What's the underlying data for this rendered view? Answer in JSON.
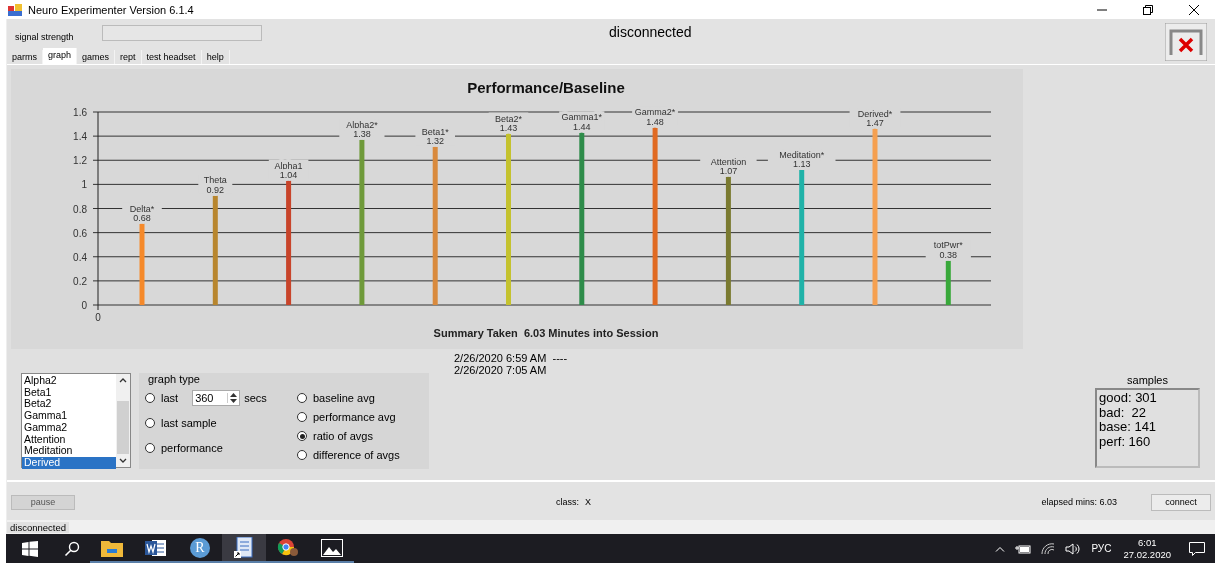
{
  "window": {
    "title": "Neuro Experimenter Version 6.1.4"
  },
  "header": {
    "signal_label": "signal strength",
    "status": "disconnected"
  },
  "tabs": [
    {
      "label": "parms",
      "selected": false
    },
    {
      "label": "graph",
      "selected": true
    },
    {
      "label": "games",
      "selected": false
    },
    {
      "label": "rept",
      "selected": false
    },
    {
      "label": "test headset",
      "selected": false
    },
    {
      "label": "help",
      "selected": false
    }
  ],
  "chart_data": {
    "type": "bar",
    "title": "Performance/Baseline",
    "xlabel": "Summary Taken  6.03 Minutes into Session",
    "series": [
      {
        "name": "Delta*",
        "color": "#f5892a",
        "values": [
          0.68
        ]
      },
      {
        "name": "Theta",
        "color": "#b8862e",
        "values": [
          0.92
        ]
      },
      {
        "name": "Alpha1",
        "color": "#c8442a",
        "values": [
          1.04
        ]
      },
      {
        "name": "Alpha2*",
        "color": "#6f9a3a",
        "values": [
          1.38
        ]
      },
      {
        "name": "Beta1*",
        "color": "#d98a3d",
        "values": [
          1.32
        ]
      },
      {
        "name": "Beta2*",
        "color": "#c4c22e",
        "values": [
          1.43
        ]
      },
      {
        "name": "Gamma1*",
        "color": "#2e8c4a",
        "values": [
          1.44
        ]
      },
      {
        "name": "Gamma2*",
        "color": "#e06a22",
        "values": [
          1.48
        ]
      },
      {
        "name": "Attention",
        "color": "#7a7a30",
        "values": [
          1.07
        ]
      },
      {
        "name": "Meditation*",
        "color": "#20b2a8",
        "values": [
          1.13
        ]
      },
      {
        "name": "Derived*",
        "color": "#f5a050",
        "values": [
          1.47
        ]
      },
      {
        "name": "totPwr*",
        "color": "#38a83a",
        "values": [
          0.38
        ]
      }
    ],
    "ylim": [
      0,
      1.6
    ],
    "yticks": [
      0,
      0.2,
      0.4,
      0.6,
      0.8,
      {
        "value": 1,
        "label": "1"
      },
      1.2,
      1.4,
      1.6
    ],
    "grid": true,
    "annotations": [
      {
        "text": "0"
      }
    ],
    "data_labels": true
  },
  "timestamps": [
    "2/26/2020 6:59 AM  ----",
    "2/26/2020 7:05 AM"
  ],
  "channel_list": [
    {
      "label": "Alpha2",
      "selected": false
    },
    {
      "label": "Beta1",
      "selected": false
    },
    {
      "label": "Beta2",
      "selected": false
    },
    {
      "label": "Gamma1",
      "selected": false
    },
    {
      "label": "Gamma2",
      "selected": false
    },
    {
      "label": "Attention",
      "selected": false
    },
    {
      "label": "Meditation",
      "selected": false
    },
    {
      "label": "Derived",
      "selected": true
    }
  ],
  "graph_type": {
    "title": "graph type",
    "left_options": [
      {
        "kind": "window",
        "label": "last",
        "value": "360",
        "unit": "secs",
        "selected": false
      },
      {
        "kind": "plain",
        "label": "last sample",
        "selected": false
      },
      {
        "kind": "plain",
        "label": "performance",
        "selected": false
      }
    ],
    "right_options": [
      {
        "kind": "plain",
        "label": "baseline avg",
        "selected": false
      },
      {
        "kind": "plain",
        "label": "performance avg",
        "selected": false
      },
      {
        "kind": "plain",
        "label": "ratio of avgs",
        "selected": true
      },
      {
        "kind": "plain",
        "label": "difference of avgs",
        "selected": false
      }
    ]
  },
  "samples": {
    "title": "samples",
    "lines": [
      "good: 301",
      "bad:  22",
      "base: 141",
      "perf: 160"
    ]
  },
  "footer": {
    "pause": "pause",
    "class_label": "class:",
    "class_value": "X",
    "elapsed": "elapsed mins: 6.03",
    "connect": "connect"
  },
  "status_bar": "disconnected",
  "taskbar": {
    "apps": [
      {
        "kind": "folder",
        "selected": false
      },
      {
        "kind": "word",
        "selected": false
      },
      {
        "kind": "r",
        "selected": false
      },
      {
        "kind": "document",
        "selected": true
      },
      {
        "kind": "browser",
        "selected": false
      },
      {
        "kind": "photos",
        "selected": false
      }
    ],
    "r_letter": "R",
    "language": "РУС",
    "time": "6:01",
    "date": "27.02.2020"
  }
}
